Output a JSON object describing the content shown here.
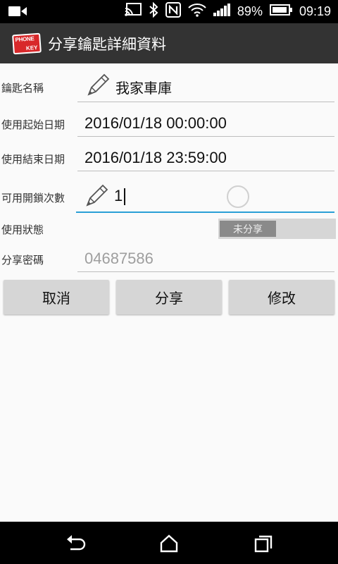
{
  "status_bar": {
    "battery_percent": "89%",
    "time": "09:19",
    "icons": [
      "video-camera-icon",
      "cast-icon",
      "bluetooth-icon",
      "nfc-icon",
      "wifi-icon",
      "cellular-signal-icon",
      "battery-icon"
    ]
  },
  "action_bar": {
    "logo_line1": "PHONE",
    "logo_line2": "KEY",
    "title": "分享鑰匙詳細資料"
  },
  "form": {
    "key_name_label": "鑰匙名稱",
    "key_name_value": "我家車庫",
    "start_date_label": "使用起始日期",
    "start_date_value": "2016/01/18 00:00:00",
    "end_date_label": "使用結束日期",
    "end_date_value": "2016/01/18 23:59:00",
    "unlock_count_label": "可用開鎖次數",
    "unlock_count_value": "1",
    "status_label": "使用狀態",
    "status_value": "未分享",
    "password_label": "分享密碼",
    "password_value": "04687586"
  },
  "buttons": {
    "cancel": "取消",
    "share": "分享",
    "modify": "修改"
  },
  "colors": {
    "accent": "#2a9fd6",
    "action_bar": "#333333",
    "logo": "#d8282a"
  }
}
